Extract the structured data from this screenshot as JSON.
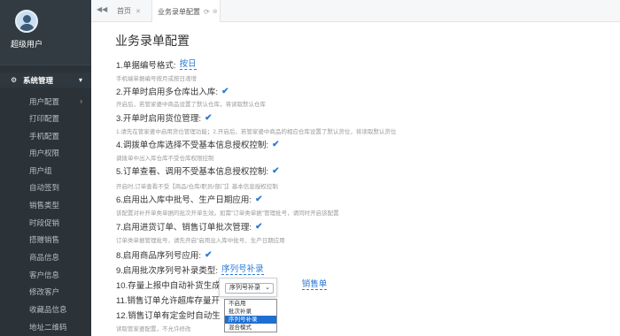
{
  "sidebar": {
    "username": "超级用户",
    "group": {
      "label": "系统管理",
      "icon": "cogs-icon"
    },
    "items": [
      {
        "label": "用户配置",
        "has_caret": true
      },
      {
        "label": "打印配置"
      },
      {
        "label": "手机配置"
      },
      {
        "label": "用户权限"
      },
      {
        "label": "用户组"
      },
      {
        "label": "自动签到"
      },
      {
        "label": "销售类型"
      },
      {
        "label": "时段促销"
      },
      {
        "label": "搭赠销售"
      },
      {
        "label": "商品信息"
      },
      {
        "label": "客户信息"
      },
      {
        "label": "修改客户"
      },
      {
        "label": "收藏品信息"
      },
      {
        "label": "地址二维码"
      }
    ]
  },
  "tabs": {
    "home": "首页",
    "active": "业务录单配置"
  },
  "main": {
    "title": "业务录单配置",
    "settings": [
      {
        "label": "1.单据编号格式:",
        "link": "按日",
        "desc": "手机端单据编号按月或按日递增"
      },
      {
        "label": "2.开单时启用多仓库出入库:",
        "check": true,
        "desc": "开启后，若管家婆中商品设置了默认仓库，将读取默认仓库"
      },
      {
        "label": "3.开单时启用货位管理:",
        "check": true,
        "desc": "1.请先在管家婆中启用货位管理功能；2.开启后，若管家婆中商品的相应仓库设置了默认货位，将读取默认货位"
      },
      {
        "label": "4.调拨单仓库选择不受基本信息授权控制:",
        "check": true,
        "desc": "调拨单中出入库仓库不受仓库权限控制"
      },
      {
        "label": "5.订单查看、调用不受基本信息授权控制:",
        "check": true,
        "desc": "开启时,订单查看不受【商品/仓库/职员/部门】基本信息授权控制"
      },
      {
        "label": "6.启用出入库中批号、生产日期应用:",
        "check": true,
        "desc": "该配置对补开单类单据的批次开单生效。如需\"订单类单据\"管理批号，请同时开启该配置"
      },
      {
        "label": "7.启用进货订单、销售订单批次管理:",
        "check": true,
        "desc": "订单类单据管理批号，请先开启\"启用出入库中批号、生产日期应用"
      },
      {
        "label": "8.启用商品序列号应用:",
        "check": true
      },
      {
        "label": "9.启用批次序列号补录类型:",
        "link": "序列号补录"
      },
      {
        "label": "10.存量上报中自动补货生成",
        "link": "销售单"
      },
      {
        "label": "11.销售订单允许超库存量开"
      },
      {
        "label": "12.销售订单有定金时自动生"
      }
    ],
    "last_desc": "读取管家婆配置，不允许修改"
  },
  "popover": {
    "selected": "序列号补录",
    "options": [
      "不启用",
      "批次补录",
      "序列号补录",
      "混合模式"
    ],
    "selected_index": 2
  }
}
